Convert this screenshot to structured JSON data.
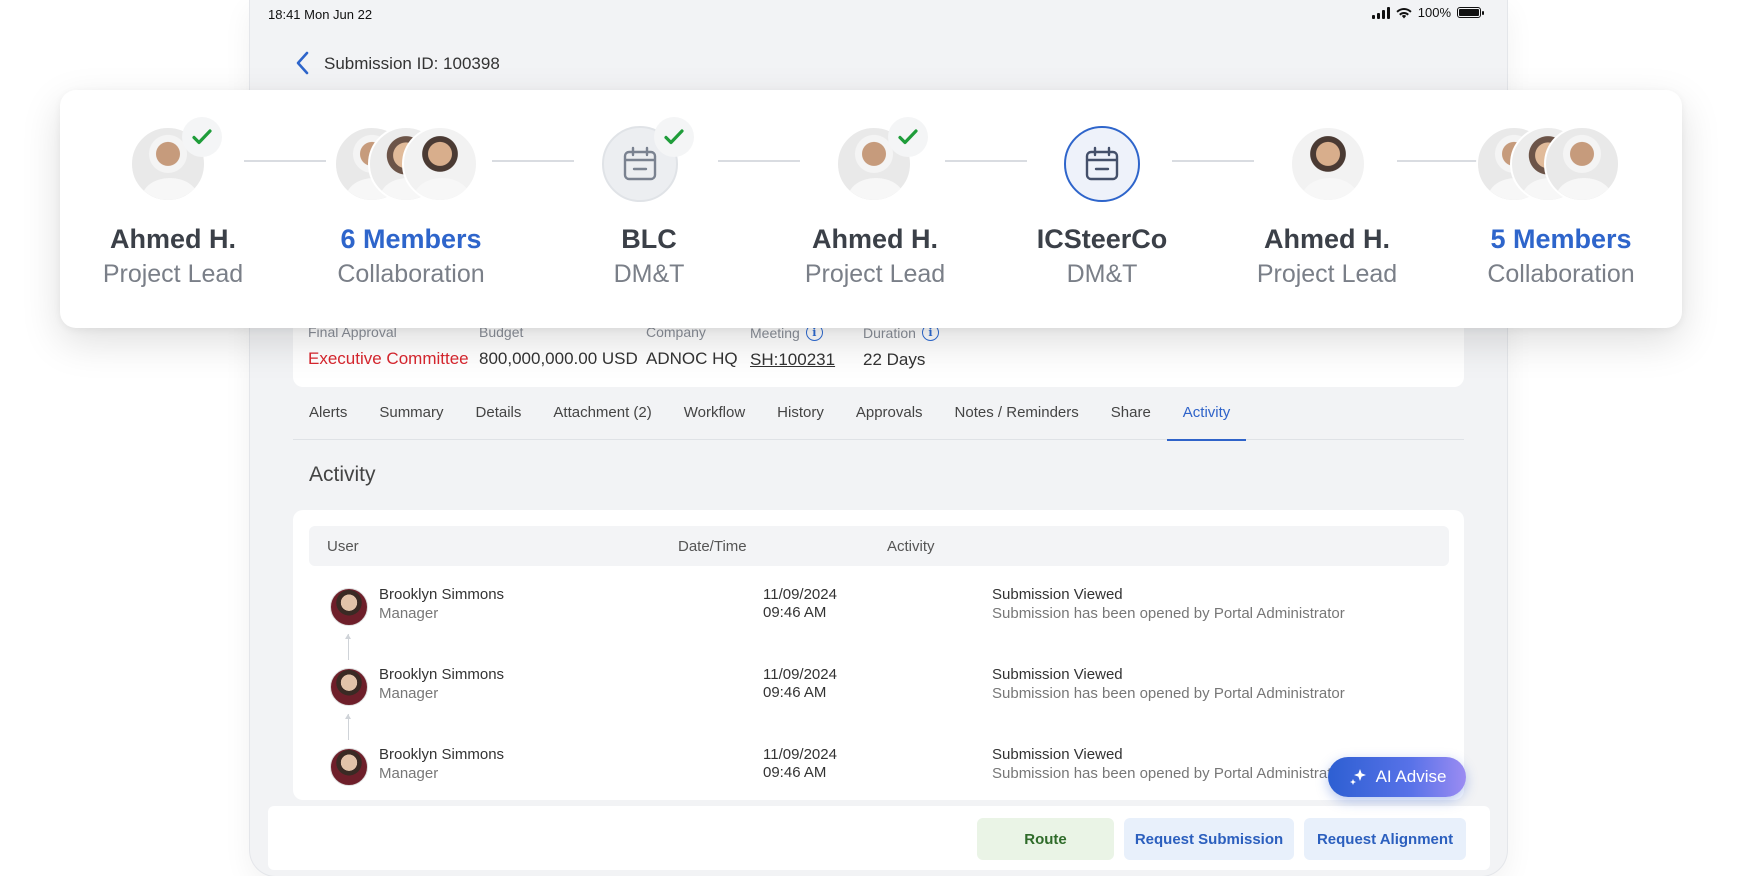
{
  "status_bar": {
    "time": "18:41 Mon Jun 22",
    "battery": "100%"
  },
  "header": {
    "submission_id": "Submission ID: 100398"
  },
  "workflow_steps": [
    {
      "name": "Ahmed H.",
      "role": "Project Lead",
      "done": true
    },
    {
      "name": "6 Members",
      "role": "Collaboration",
      "group": true
    },
    {
      "name": "BLC",
      "role": "DM&T",
      "done": true
    },
    {
      "name": "Ahmed H.",
      "role": "Project Lead",
      "done": true
    },
    {
      "name": "ICSteerCo",
      "role": "DM&T",
      "current": true
    },
    {
      "name": "Ahmed H.",
      "role": "Project Lead"
    },
    {
      "name": "5 Members",
      "role": "Collaboration",
      "group": true
    }
  ],
  "info": {
    "final_approval": {
      "label": "Final Approval",
      "value": "Executive Committee"
    },
    "budget": {
      "label": "Budget",
      "value": "800,000,000.00 USD"
    },
    "company": {
      "label": "Company",
      "value": "ADNOC HQ"
    },
    "meeting": {
      "label": "Meeting",
      "value": "SH:100231"
    },
    "duration": {
      "label": "Duration",
      "value": "22 Days"
    }
  },
  "tabs": [
    "Alerts",
    "Summary",
    "Details",
    "Attachment (2)",
    "Workflow",
    "History",
    "Approvals",
    "Notes / Reminders",
    "Share",
    "Activity"
  ],
  "active_tab": "Activity",
  "activity": {
    "title": "Activity",
    "columns": {
      "user": "User",
      "datetime": "Date/Time",
      "activity": "Activity"
    },
    "rows": [
      {
        "name": "Brooklyn Simmons",
        "role": "Manager",
        "date": "11/09/2024",
        "time": "09:46 AM",
        "title": "Submission Viewed",
        "desc": "Submission has been opened by Portal Administrator"
      },
      {
        "name": "Brooklyn Simmons",
        "role": "Manager",
        "date": "11/09/2024",
        "time": "09:46 AM",
        "title": "Submission Viewed",
        "desc": "Submission has been opened by Portal Administrator"
      },
      {
        "name": "Brooklyn Simmons",
        "role": "Manager",
        "date": "11/09/2024",
        "time": "09:46 AM",
        "title": "Submission Viewed",
        "desc": "Submission has been opened by Portal Administrator"
      }
    ]
  },
  "ai_button": "AI Advise",
  "footer": {
    "route": "Route",
    "request_submission": "Request Submission",
    "request_alignment": "Request Alignment"
  },
  "colors": {
    "accent": "#2e65cb",
    "danger": "#d8262e",
    "check": "#1f9d3a",
    "route_bg": "#eaf4e6"
  }
}
